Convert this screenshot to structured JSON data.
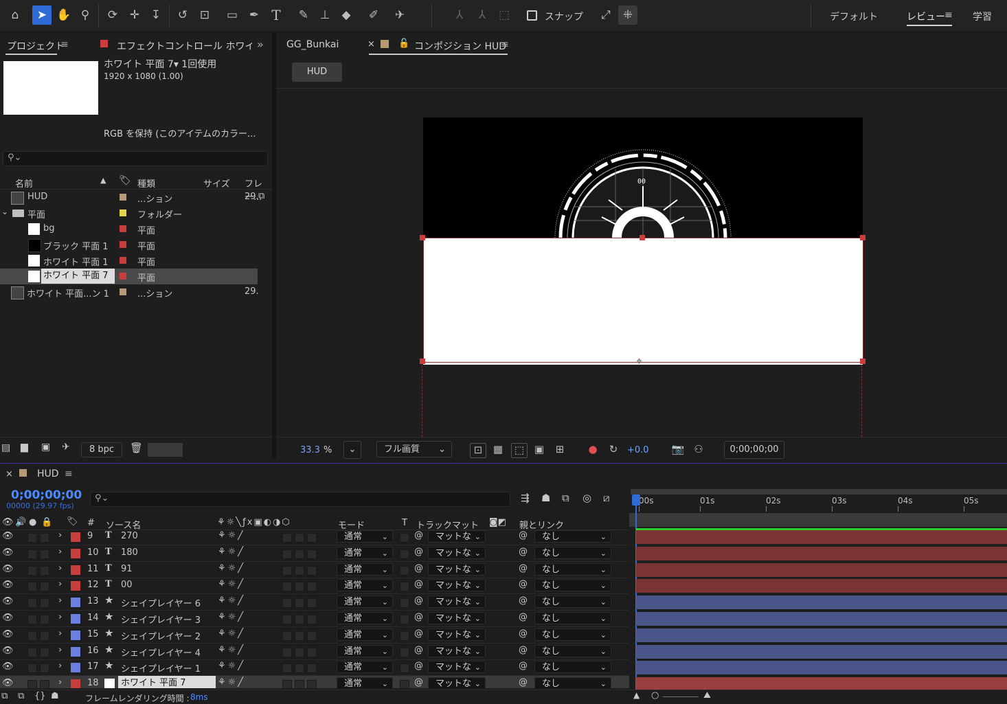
{
  "toolbar": {
    "icons": [
      "home-icon",
      "selection-tool-icon",
      "hand-tool-icon",
      "zoom-tool-icon",
      "orbit-camera-icon",
      "pan-camera-icon",
      "dolly-camera-icon",
      "rotate-tool-icon",
      "anchor-point-tool-icon",
      "rectangle-tool-icon",
      "pen-tool-icon",
      "type-tool-icon",
      "brush-tool-icon",
      "clone-stamp-icon",
      "eraser-icon",
      "roto-brush-icon",
      "puppet-pin-icon"
    ],
    "snap_label": "スナップ",
    "workspaces": [
      "デフォルト",
      "レビュー",
      "学習"
    ],
    "active_workspace": "レビュー"
  },
  "project_panel": {
    "tab_project": "プロジェクト",
    "tab_effects": "エフェクトコントロール ホワイト 平面",
    "item_name": "ホワイト 平面 7",
    "usage": "1回使用",
    "dimensions": "1920 x 1080 (1.00)",
    "color_note": "RGB を保持 (このアイテムのカラー...",
    "search_placeholder": "",
    "columns": {
      "name": "名前",
      "type": "種類",
      "size": "サイズ",
      "frame": "フレー..."
    },
    "items": [
      {
        "name": "HUD",
        "type": "...ション",
        "frame": "29.",
        "label_color": "#b59a78",
        "icon": "composition-icon"
      },
      {
        "name": "平面",
        "type": "フォルダー",
        "frame": "",
        "label_color": "#e4d54a",
        "icon": "folder-icon"
      },
      {
        "name": "bg",
        "type": "平面",
        "frame": "",
        "label_color": "#c93d3d",
        "icon": "white-solid-icon"
      },
      {
        "name": "ブラック 平面 1",
        "type": "平面",
        "frame": "",
        "label_color": "#c93d3d",
        "icon": "black-solid-icon"
      },
      {
        "name": "ホワイト 平面 1",
        "type": "平面",
        "frame": "",
        "label_color": "#c93d3d",
        "icon": "white-solid-icon"
      },
      {
        "name": "ホワイト 平面 7",
        "type": "平面",
        "frame": "",
        "label_color": "#c93d3d",
        "icon": "white-solid-icon"
      },
      {
        "name": "ホワイト 平面...ン 1",
        "type": "...ション",
        "frame": "29.",
        "label_color": "#b59a78",
        "icon": "composition-icon"
      }
    ],
    "bpc": "8 bpc"
  },
  "composition_panel": {
    "tab_other": "GG_Bunkai",
    "tab_active": "コンポジション HUD",
    "breadcrumb": "HUD",
    "hud_label": "00",
    "zoom": "33.3",
    "zoom_unit": "%",
    "quality": "フル画質",
    "exposure": "+0.0",
    "timecode": "0;00;00;00"
  },
  "timeline": {
    "comp_name": "HUD",
    "timecode": "0;00;00;00",
    "frame_info": "00000 (29.97 fps)",
    "search_placeholder": "",
    "columns": {
      "num": "#",
      "source": "ソース名",
      "mode": "モード",
      "t": "T",
      "trackmatte": "トラックマット",
      "parent": "親とリンク"
    },
    "ruler": [
      "00s",
      "01s",
      "02s",
      "03s",
      "04s",
      "05s"
    ],
    "layers": [
      {
        "num": "9",
        "kind": "T",
        "name": "270",
        "color": "#c93d3d",
        "mode": "通常",
        "matte": "マットな",
        "parent": "なし",
        "bar": "#7a3434"
      },
      {
        "num": "10",
        "kind": "T",
        "name": "180",
        "color": "#c93d3d",
        "mode": "通常",
        "matte": "マットな",
        "parent": "なし",
        "bar": "#7a3434"
      },
      {
        "num": "11",
        "kind": "T",
        "name": "91",
        "color": "#c93d3d",
        "mode": "通常",
        "matte": "マットな",
        "parent": "なし",
        "bar": "#7a3434"
      },
      {
        "num": "12",
        "kind": "T",
        "name": "00",
        "color": "#c93d3d",
        "mode": "通常",
        "matte": "マットな",
        "parent": "なし",
        "bar": "#7a3434"
      },
      {
        "num": "13",
        "kind": "★",
        "name": "シェイプレイヤー 6",
        "color": "#6c7ee0",
        "mode": "通常",
        "matte": "マットな",
        "parent": "なし",
        "bar": "#4a568a"
      },
      {
        "num": "14",
        "kind": "★",
        "name": "シェイプレイヤー 3",
        "color": "#6c7ee0",
        "mode": "通常",
        "matte": "マットな",
        "parent": "なし",
        "bar": "#4a568a"
      },
      {
        "num": "15",
        "kind": "★",
        "name": "シェイプレイヤー 2",
        "color": "#6c7ee0",
        "mode": "通常",
        "matte": "マットな",
        "parent": "なし",
        "bar": "#4a568a"
      },
      {
        "num": "16",
        "kind": "★",
        "name": "シェイプレイヤー 4",
        "color": "#6c7ee0",
        "mode": "通常",
        "matte": "マットな",
        "parent": "なし",
        "bar": "#4a568a"
      },
      {
        "num": "17",
        "kind": "★",
        "name": "シェイプレイヤー 1",
        "color": "#6c7ee0",
        "mode": "通常",
        "matte": "マットな",
        "parent": "なし",
        "bar": "#4a568a"
      },
      {
        "num": "18",
        "kind": "□",
        "name": "ホワイト 平面 7",
        "color": "#c93d3d",
        "mode": "通常",
        "matte": "マットな",
        "parent": "なし",
        "bar": "#9a3f3f"
      }
    ],
    "render_label": "フレームレンダリング時間 :",
    "render_time": "8ms"
  }
}
